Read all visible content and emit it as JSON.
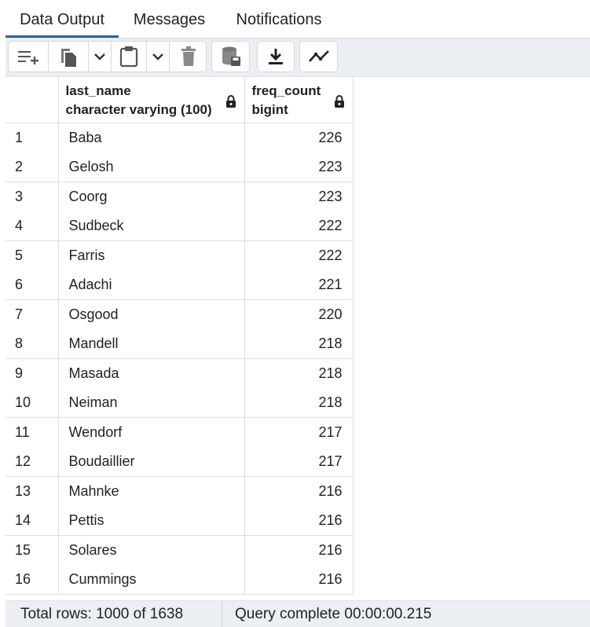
{
  "tabs": [
    "Data Output",
    "Messages",
    "Notifications"
  ],
  "toolbar": {
    "icons": [
      "add-row-icon",
      "copy-icon",
      "chevron-down-icon",
      "paste-icon",
      "chevron-down-icon",
      "delete-icon",
      "save-data-icon",
      "download-icon",
      "graph-icon"
    ]
  },
  "columns": [
    {
      "name": "last_name",
      "type": "character varying (100)"
    },
    {
      "name": "freq_count",
      "type": "bigint"
    }
  ],
  "rows": [
    {
      "num": "1",
      "last_name": "Baba",
      "freq_count": "226"
    },
    {
      "num": "2",
      "last_name": "Gelosh",
      "freq_count": "223"
    },
    {
      "num": "3",
      "last_name": "Coorg",
      "freq_count": "223"
    },
    {
      "num": "4",
      "last_name": "Sudbeck",
      "freq_count": "222"
    },
    {
      "num": "5",
      "last_name": "Farris",
      "freq_count": "222"
    },
    {
      "num": "6",
      "last_name": "Adachi",
      "freq_count": "221"
    },
    {
      "num": "7",
      "last_name": "Osgood",
      "freq_count": "220"
    },
    {
      "num": "8",
      "last_name": "Mandell",
      "freq_count": "218"
    },
    {
      "num": "9",
      "last_name": "Masada",
      "freq_count": "218"
    },
    {
      "num": "10",
      "last_name": "Neiman",
      "freq_count": "218"
    },
    {
      "num": "11",
      "last_name": "Wendorf",
      "freq_count": "217"
    },
    {
      "num": "12",
      "last_name": "Boudaillier",
      "freq_count": "217"
    },
    {
      "num": "13",
      "last_name": "Mahnke",
      "freq_count": "216"
    },
    {
      "num": "14",
      "last_name": "Pettis",
      "freq_count": "216"
    },
    {
      "num": "15",
      "last_name": "Solares",
      "freq_count": "216"
    },
    {
      "num": "16",
      "last_name": "Cummings",
      "freq_count": "216"
    }
  ],
  "status": {
    "total_rows": "Total rows: 1000 of 1638",
    "query": "Query complete 00:00:00.215"
  },
  "colors": {
    "accent": "#326690",
    "toolbar_bg": "#ebeef3",
    "icon": "#555555"
  }
}
